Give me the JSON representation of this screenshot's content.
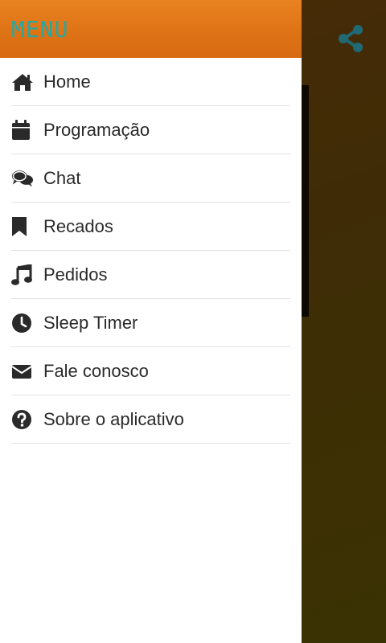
{
  "drawer": {
    "title": "MENU",
    "items": [
      {
        "label": "Home",
        "icon": "home-icon"
      },
      {
        "label": "Programação",
        "icon": "calendar-icon"
      },
      {
        "label": "Chat",
        "icon": "chat-icon"
      },
      {
        "label": "Recados",
        "icon": "bookmark-icon"
      },
      {
        "label": "Pedidos",
        "icon": "music-icon"
      },
      {
        "label": "Sleep Timer",
        "icon": "clock-icon"
      },
      {
        "label": "Fale conosco",
        "icon": "envelope-icon"
      },
      {
        "label": "Sobre o aplicativo",
        "icon": "question-icon"
      }
    ]
  },
  "colors": {
    "header_orange": "#e07a1a",
    "title_teal": "#2aa7a0",
    "icon_dark": "#2a2a2a",
    "share_teal": "#1f6a74"
  }
}
